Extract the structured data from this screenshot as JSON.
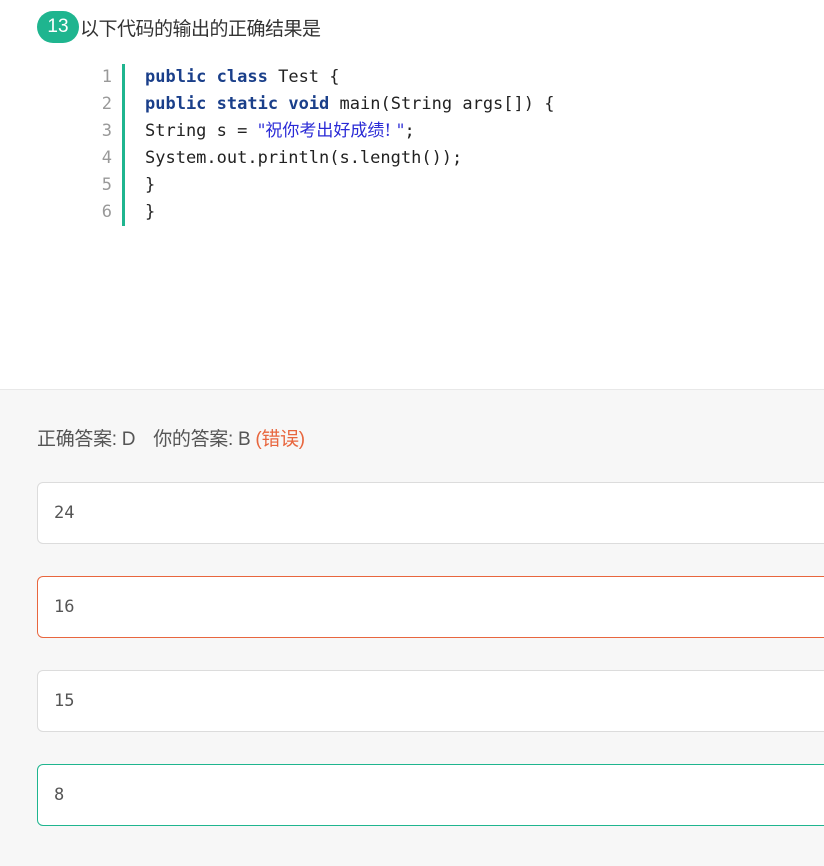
{
  "question": {
    "number": "13",
    "title": "以下代码的输出的正确结果是"
  },
  "code": {
    "lines": [
      {
        "no": "1",
        "parts": [
          {
            "t": "public",
            "k": "kw"
          },
          {
            "t": " "
          },
          {
            "t": "class",
            "k": "kw"
          },
          {
            "t": " Test {"
          }
        ]
      },
      {
        "no": "2",
        "parts": [
          {
            "t": "public",
            "k": "kw"
          },
          {
            "t": " "
          },
          {
            "t": "static",
            "k": "kw"
          },
          {
            "t": " "
          },
          {
            "t": "void",
            "k": "kw"
          },
          {
            "t": " main(String args[]) {"
          }
        ]
      },
      {
        "no": "3",
        "parts": [
          {
            "t": "String s = "
          },
          {
            "t": "\"祝你考出好成绩! \"",
            "k": "str"
          },
          {
            "t": ";"
          }
        ]
      },
      {
        "no": "4",
        "parts": [
          {
            "t": "System.out.println(s.length());"
          }
        ]
      },
      {
        "no": "5",
        "parts": [
          {
            "t": "}"
          }
        ]
      },
      {
        "no": "6",
        "parts": [
          {
            "t": "}"
          }
        ]
      }
    ]
  },
  "answer": {
    "correct_label": "正确答案: D",
    "your_label": "你的答案: B",
    "result": "(错误)"
  },
  "options": [
    {
      "id": "A",
      "value": "24",
      "state": "normal"
    },
    {
      "id": "B",
      "value": "16",
      "state": "selected-wrong"
    },
    {
      "id": "C",
      "value": "15",
      "state": "normal"
    },
    {
      "id": "D",
      "value": "8",
      "state": "correct"
    }
  ],
  "colors": {
    "accent": "#1fb58f",
    "wrong": "#e8663e"
  }
}
